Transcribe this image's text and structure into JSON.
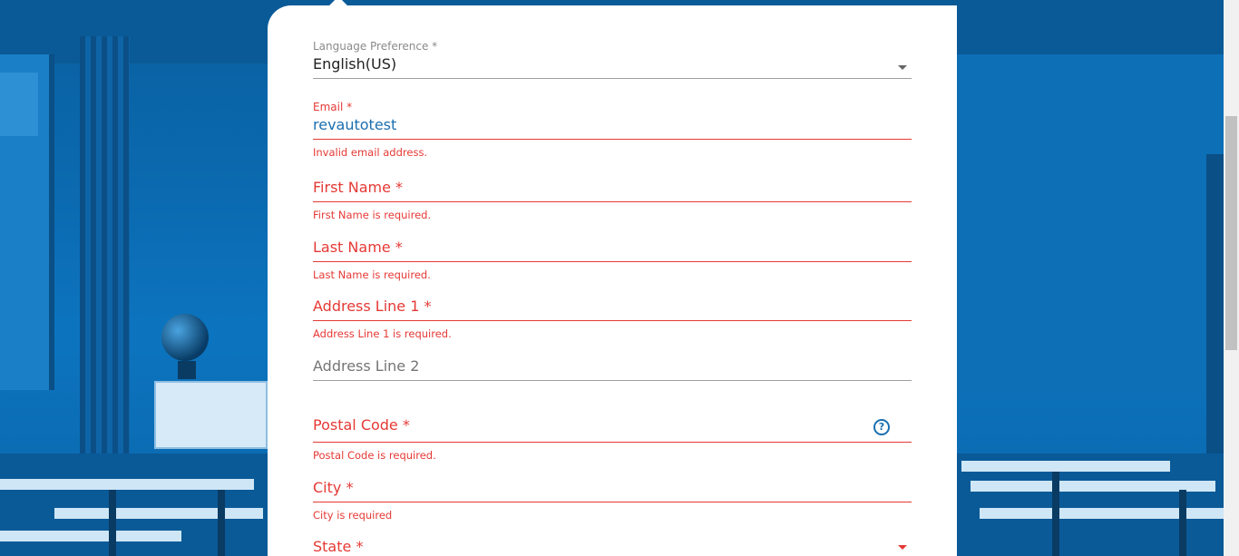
{
  "form": {
    "language": {
      "label": "Language Preference *",
      "value": "English(US)"
    },
    "email": {
      "label": "Email *",
      "value": "revautotest",
      "error": "Invalid email address."
    },
    "first_name": {
      "placeholder": "First Name *",
      "error": "First Name is required."
    },
    "last_name": {
      "placeholder": "Last Name *",
      "error": "Last Name is required."
    },
    "address1": {
      "placeholder": "Address Line 1 *",
      "error": "Address Line 1 is required."
    },
    "address2": {
      "placeholder": "Address Line 2"
    },
    "postal_code": {
      "placeholder": "Postal Code *",
      "error": "Postal Code is required.",
      "help_icon": "question-circle-icon"
    },
    "city": {
      "placeholder": "City *",
      "error": "City is required"
    },
    "state": {
      "placeholder": "State *"
    }
  },
  "colors": {
    "error": "#e53935",
    "accent": "#1a6fb0",
    "background": "#0b6fb8"
  }
}
